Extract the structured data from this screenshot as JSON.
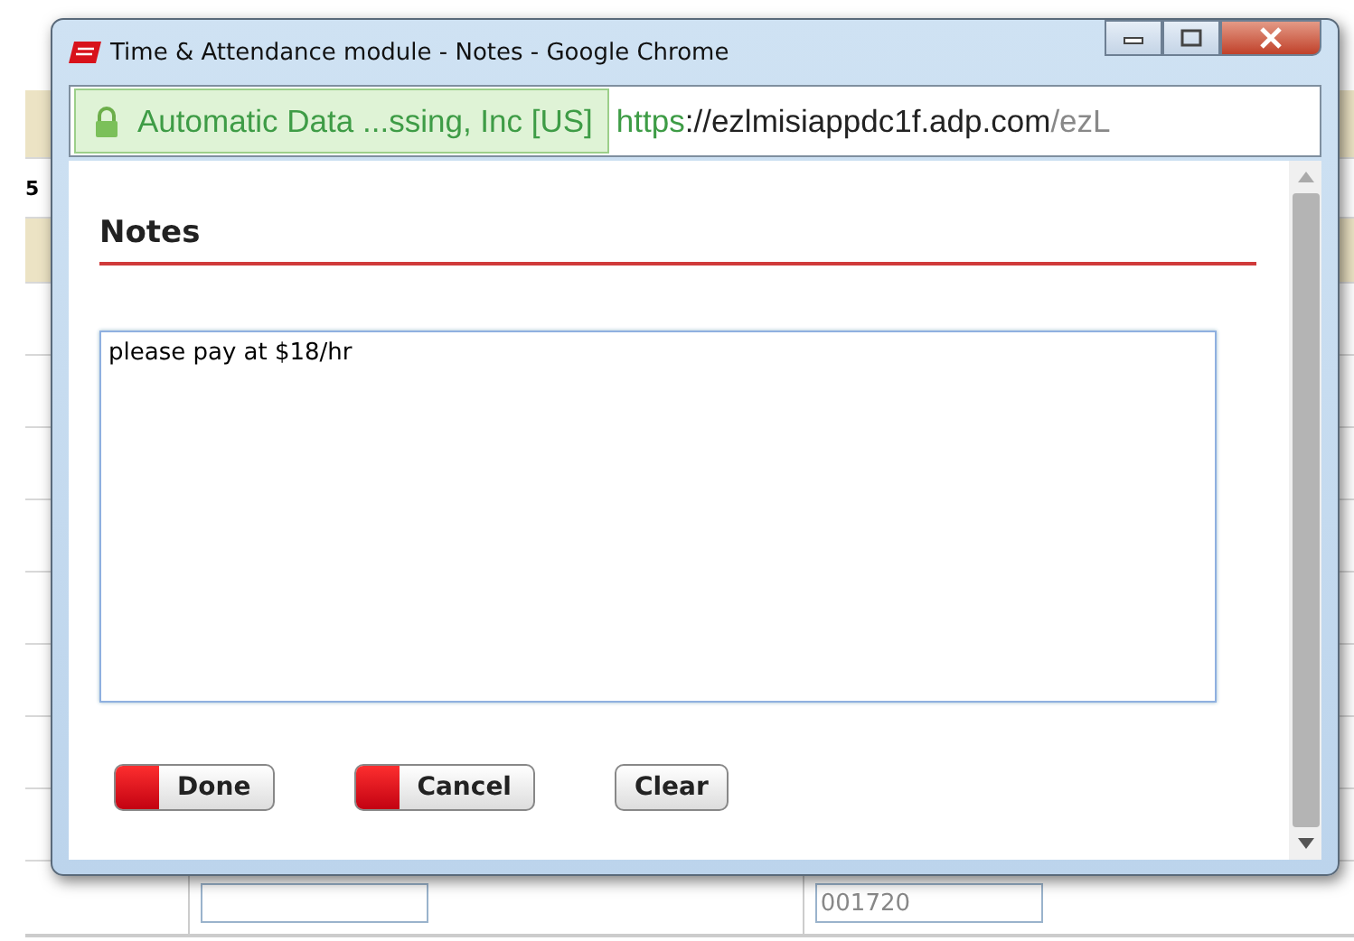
{
  "window": {
    "title": "Time & Attendance module - Notes - Google Chrome"
  },
  "address_bar": {
    "site_identity": "Automatic Data ...ssing, Inc [US]",
    "url_scheme": "https",
    "url_host": "://ezlmisiappdc1f.adp.com",
    "url_path": "/ezL"
  },
  "dialog": {
    "heading": "Notes",
    "note": {
      "value": "please pay at $18/hr"
    },
    "buttons": [
      {
        "label": "Done",
        "kind": "primary"
      },
      {
        "label": "Cancel",
        "kind": "primary"
      },
      {
        "label": "Clear",
        "kind": "plain"
      }
    ]
  },
  "background_page": {
    "row_label": "5",
    "field_value": "001720"
  }
}
